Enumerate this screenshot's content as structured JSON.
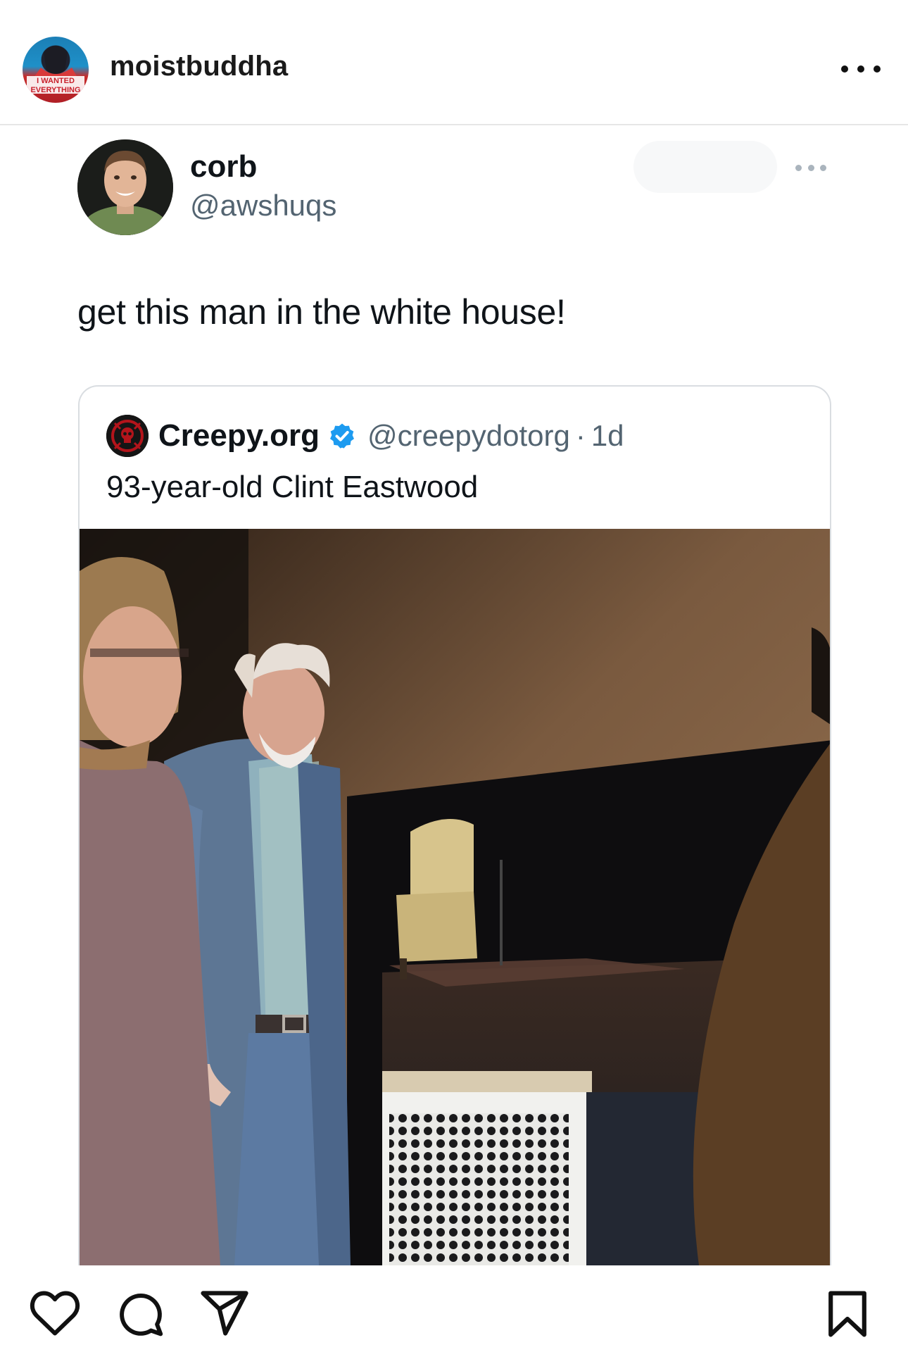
{
  "post": {
    "username": "moistbuddha",
    "avatar_text": [
      "I WANTED",
      "EVERYTHING"
    ]
  },
  "tweet": {
    "display_name": "corb",
    "handle": "@awshuqs",
    "text": "get this man in the white house!"
  },
  "quoted_tweet": {
    "display_name": "Creepy.org",
    "handle": "@creepydotorg",
    "separator": "·",
    "age": "1d",
    "text": "93-year-old Clint Eastwood",
    "verified": true
  },
  "actions": {
    "icons": [
      "heart-icon",
      "comment-icon",
      "share-icon",
      "bookmark-icon"
    ]
  },
  "colors": {
    "text_primary": "#0f1419",
    "text_secondary": "#536471",
    "verified_blue": "#1d9bf0",
    "divider": "#e6e6e6"
  }
}
